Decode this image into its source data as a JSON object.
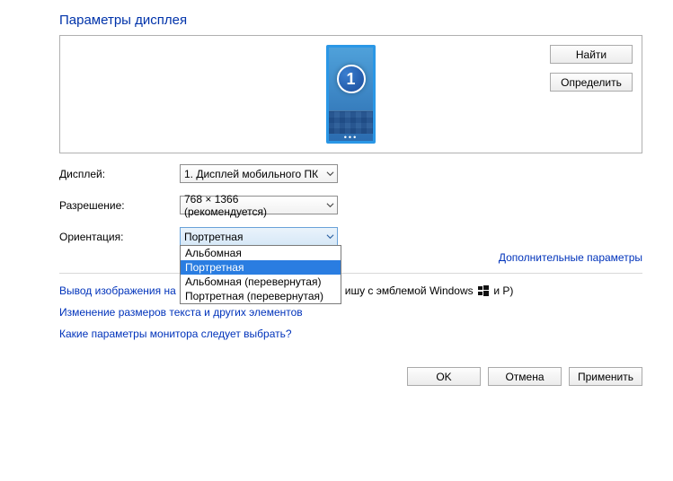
{
  "title": "Параметры дисплея",
  "buttons": {
    "detect": "Найти",
    "identify": "Определить",
    "ok": "OK",
    "cancel": "Отмена",
    "apply": "Применить"
  },
  "monitor": {
    "number": "1"
  },
  "labels": {
    "display": "Дисплей:",
    "resolution": "Разрешение:",
    "orientation": "Ориентация:"
  },
  "combos": {
    "display": "1. Дисплей мобильного ПК",
    "resolution": "768 × 1366 (рекомендуется)",
    "orientation": "Портретная"
  },
  "orientation_options": [
    "Альбомная",
    "Портретная",
    "Альбомная (перевернутая)",
    "Портретная (перевернутая)"
  ],
  "orientation_selected_index": 1,
  "links": {
    "advanced": "Дополнительные параметры",
    "project_prefix": "Вывод изображения на",
    "project_suffix_visible": "ишу с эмблемой Windows",
    "project_hint_tail": " и P)",
    "textsize": "Изменение размеров текста и других элементов",
    "which": "Какие параметры монитора следует выбрать?"
  }
}
